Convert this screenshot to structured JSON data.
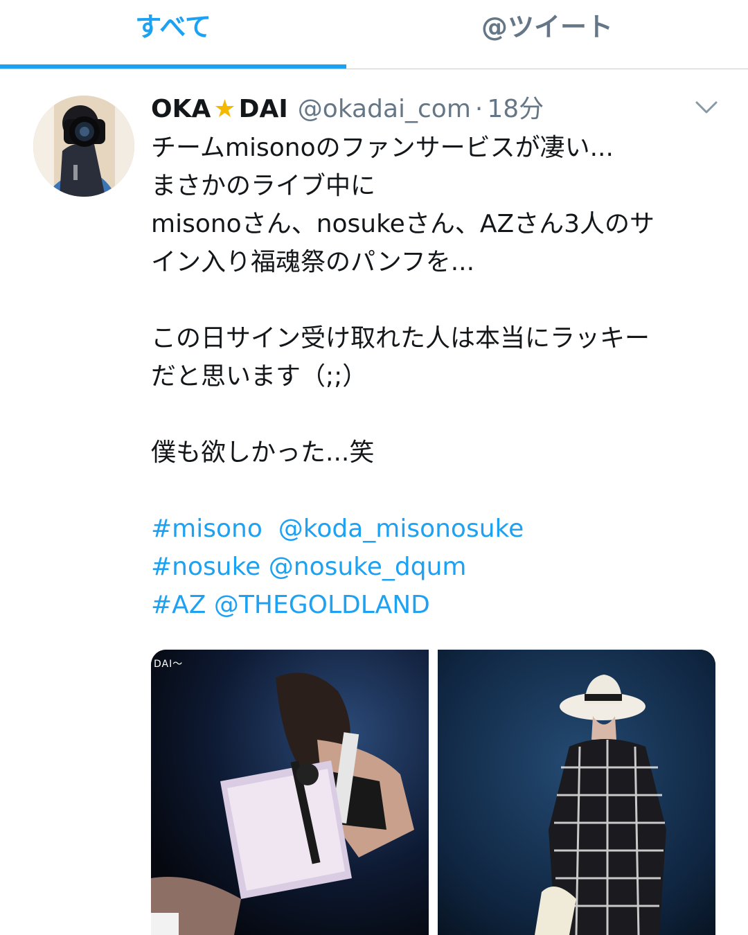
{
  "tabs": [
    {
      "label": "すべて",
      "active": true
    },
    {
      "label": "@ツイート",
      "active": false
    }
  ],
  "colors": {
    "accent": "#1da1f2",
    "secondary_text": "#657786",
    "primary_text": "#14171a"
  },
  "tweet": {
    "display_name_part1": "OKA",
    "display_name_icon": "star-emoji-icon",
    "display_name_part2": "DAI",
    "handle": "@okadai_com",
    "separator": "·",
    "time": "18分",
    "lines": [
      "チームmisonoのファンサービスが凄い...",
      "まさかのライブ中に",
      "misonoさん、nosukeさん、AZさん3人のサ",
      "イン入り福魂祭のパンフを...",
      "この日サイン受け取れた人は本当にラッキー",
      "だと思います（;;）",
      "僕も欲しかった...笑"
    ],
    "hashtag_lines": [
      {
        "tag": "#misono",
        "mention": "@koda_misonosuke"
      },
      {
        "tag": "#nosuke",
        "mention": "@nosuke_dqum"
      },
      {
        "tag": "#AZ",
        "mention": "@THEGOLDLAND"
      }
    ],
    "photo_watermark": "DAI〜"
  }
}
